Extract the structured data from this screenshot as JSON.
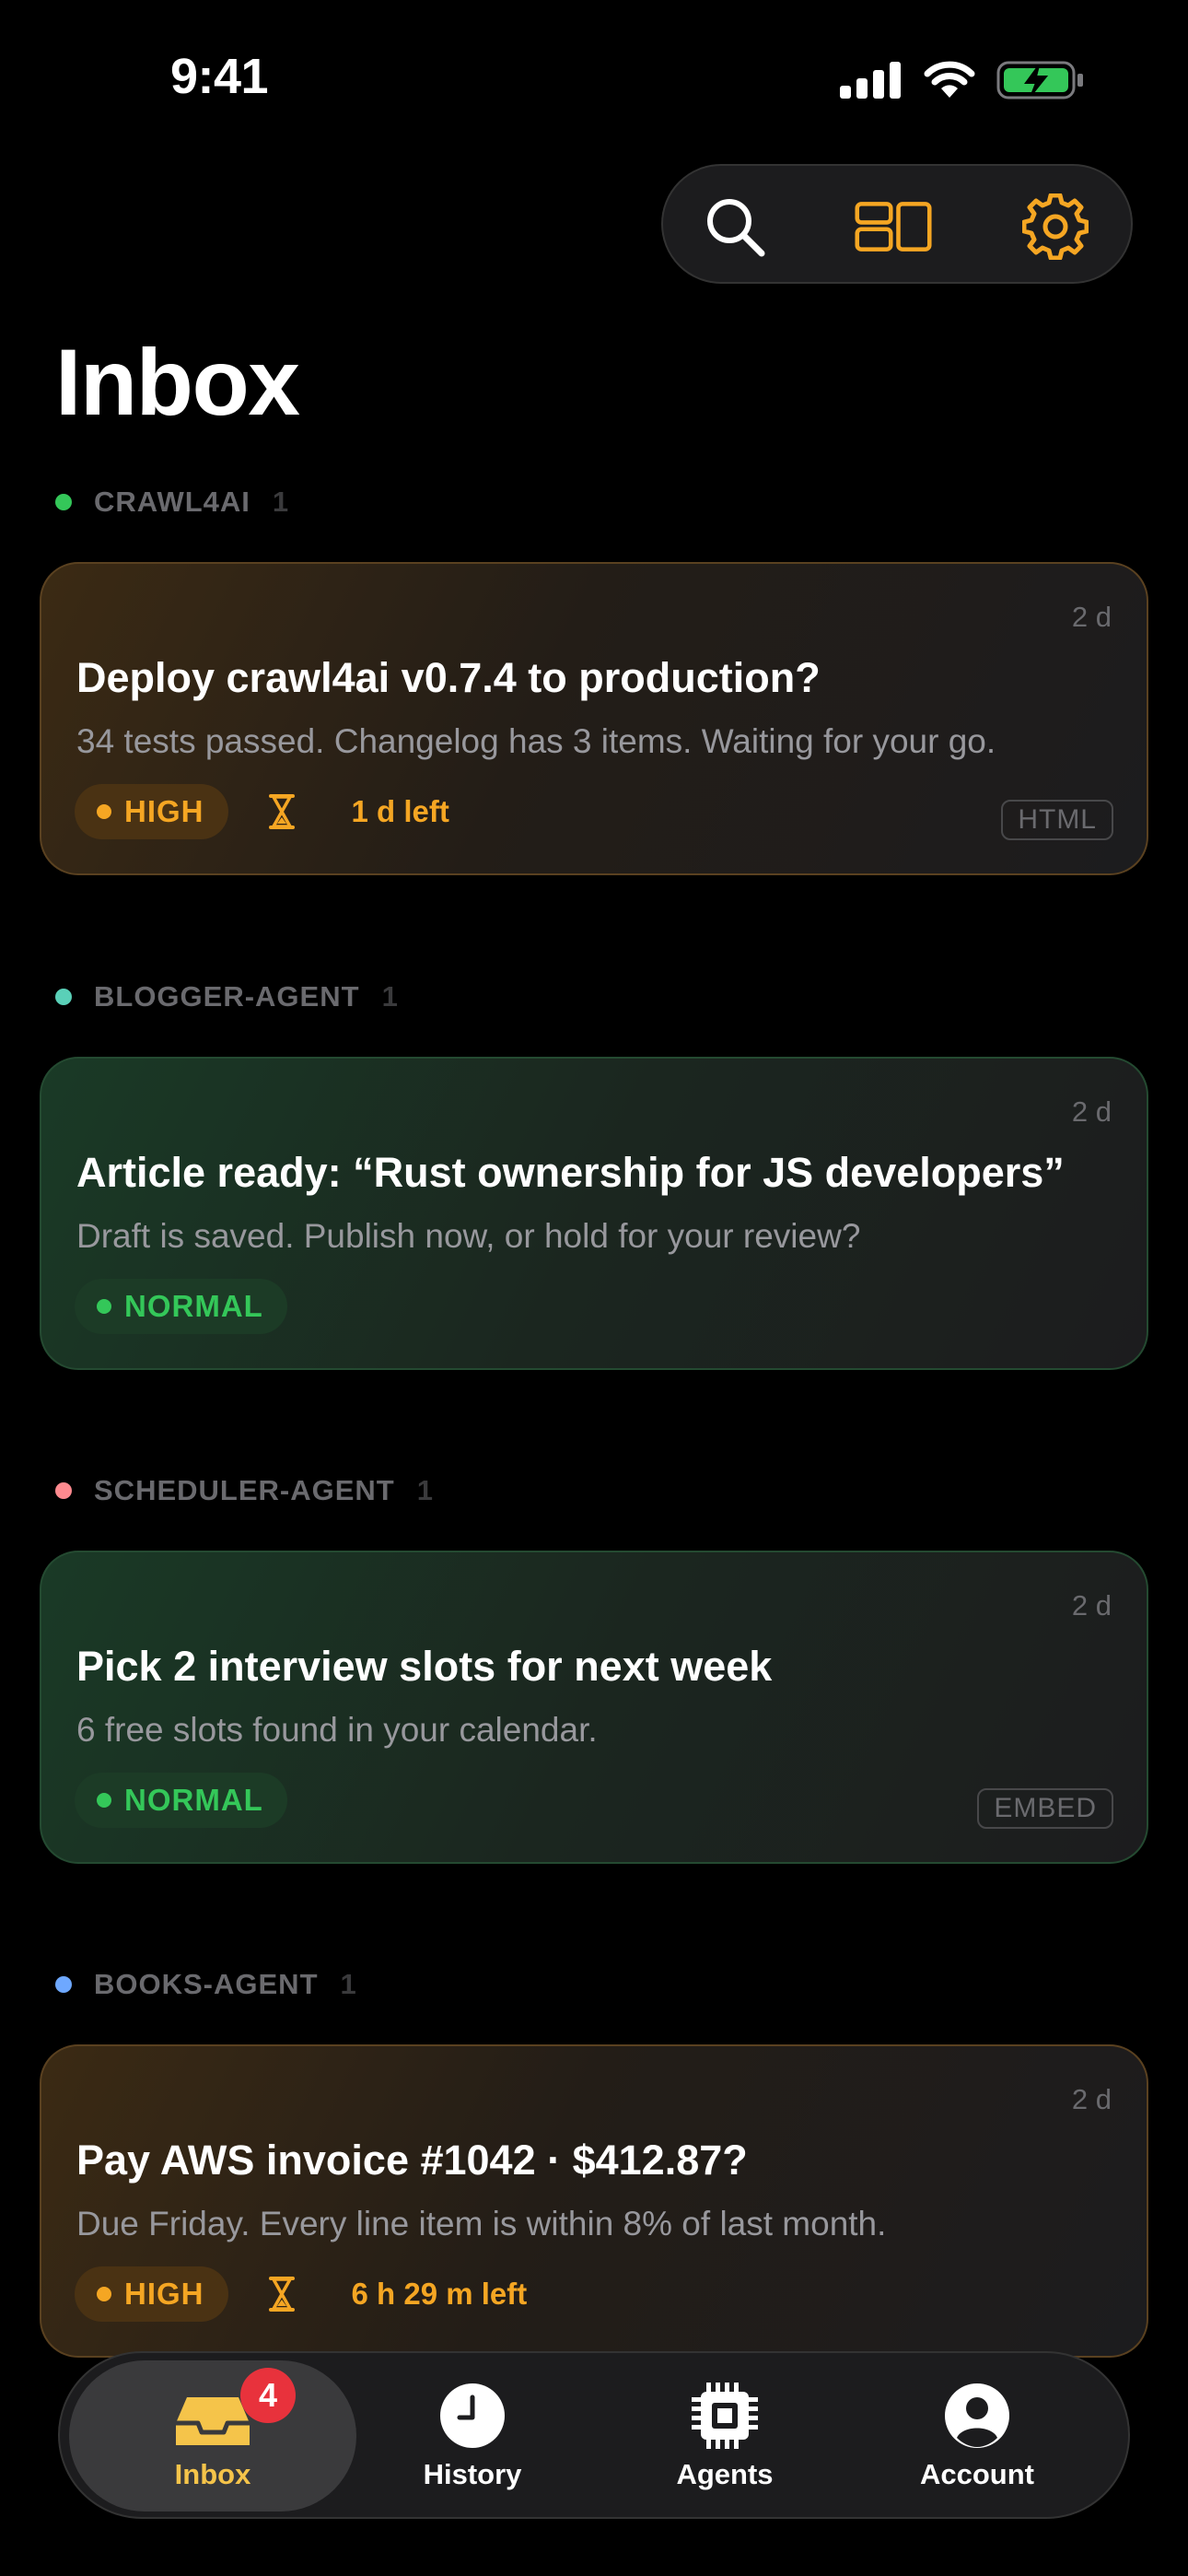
{
  "status_bar": {
    "time": "9:41"
  },
  "page": {
    "title": "Inbox"
  },
  "toolbar": {
    "icons": [
      "search-icon",
      "layout-icon",
      "gear-icon"
    ],
    "accent": "#f5a623"
  },
  "groups": [
    {
      "name": "CRAWL4AI",
      "count": "1",
      "dot_color": "#34c759",
      "card": {
        "age": "2 d",
        "title": "Deploy crawl4ai v0.7.4 to production?",
        "subtitle": "34 tests passed. Changelog has 3 items. Waiting for your go.",
        "priority": "HIGH",
        "deadline": "1 d left",
        "tag": "HTML"
      }
    },
    {
      "name": "BLOGGER-AGENT",
      "count": "1",
      "dot_color": "#5ad0b8",
      "card": {
        "age": "2 d",
        "title": "Article ready: “Rust ownership for JS developers”",
        "subtitle": "Draft is saved. Publish now, or hold for your review?",
        "priority": "NORMAL"
      }
    },
    {
      "name": "SCHEDULER-AGENT",
      "count": "1",
      "dot_color": "#ff8a8f",
      "card": {
        "age": "2 d",
        "title": "Pick 2 interview slots for next week",
        "subtitle": "6 free slots found in your calendar.",
        "priority": "NORMAL",
        "tag": "EMBED"
      }
    },
    {
      "name": "BOOKS-AGENT",
      "count": "1",
      "dot_color": "#6ea8ff",
      "card": {
        "age": "2 d",
        "title": "Pay AWS invoice #1042 · $412.87?",
        "subtitle": "Due Friday. Every line item is within 8% of last month.",
        "priority": "HIGH",
        "deadline": "6 h 29 m left"
      }
    }
  ],
  "tabbar": {
    "tabs": [
      {
        "label": "Inbox",
        "icon": "inbox-icon",
        "badge": "4",
        "active": true
      },
      {
        "label": "History",
        "icon": "clock-icon"
      },
      {
        "label": "Agents",
        "icon": "chip-icon"
      },
      {
        "label": "Account",
        "icon": "person-icon"
      }
    ]
  }
}
